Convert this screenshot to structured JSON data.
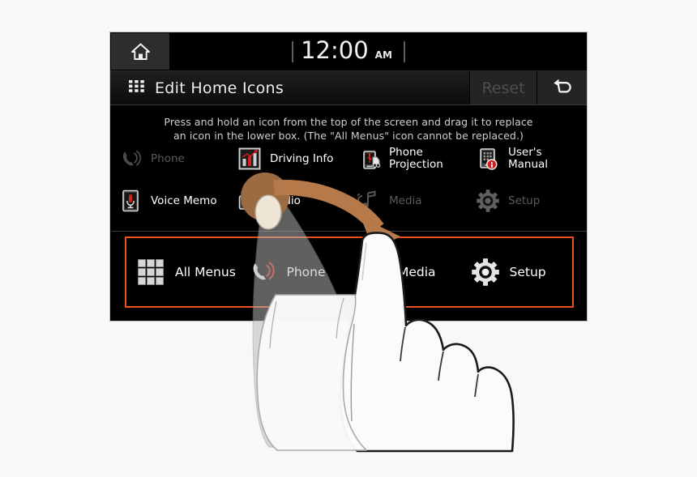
{
  "status_bar": {
    "home_icon": "home-icon",
    "clock_time": "12:00",
    "clock_meridiem": "AM"
  },
  "title_bar": {
    "grid_icon": "grid-menu-icon",
    "title": "Edit Home Icons",
    "reset_label": "Reset",
    "reset_enabled": false,
    "back_icon": "back-arrow-icon"
  },
  "instructions": {
    "line1": "Press and hold an icon from the top of the screen and drag it to replace",
    "line2": "an icon in the lower box. (The \"All Menus\" icon cannot be replaced.)"
  },
  "icon_pool": {
    "rows": [
      [
        {
          "label": "Phone",
          "icon": "phone-handset-icon",
          "disabled": true
        },
        {
          "label": "Driving Info",
          "icon": "bar-chart-icon",
          "disabled": false
        },
        {
          "label": "Phone\nProjection",
          "icon": "phone-projection-icon",
          "disabled": false
        },
        {
          "label": "User's\nManual",
          "icon": "users-manual-icon",
          "disabled": false
        }
      ],
      [
        {
          "label": "Voice Memo",
          "icon": "microphone-icon",
          "disabled": false
        },
        {
          "label": "Radio",
          "icon": "radio-icon",
          "disabled": false
        },
        {
          "label": "Media",
          "icon": "media-note-icon",
          "disabled": true
        },
        {
          "label": "Setup",
          "icon": "gear-icon",
          "disabled": true
        }
      ]
    ]
  },
  "dock": {
    "border_color": "#e8501e",
    "items": [
      {
        "label": "All Menus",
        "icon": "all-menus-grid-icon"
      },
      {
        "label": "Phone",
        "icon": "phone-handset-icon"
      },
      {
        "label": "Media",
        "icon": "media-note-icon"
      },
      {
        "label": "Setup",
        "icon": "gear-icon"
      }
    ]
  },
  "gesture_overlay": {
    "drag_arrow_color": "#b5794a",
    "touch_circle_color": "#9d6b42",
    "hand_fill": "#fbfbfb",
    "hand_outline": "#1a1a1a",
    "drag_ghost_color": "#9a9a9a"
  },
  "colors": {
    "page_background": "#f8f8f8",
    "screen_background": "#000000",
    "accent_red": "#d32020",
    "disabled_text": "#5a5a5a"
  }
}
